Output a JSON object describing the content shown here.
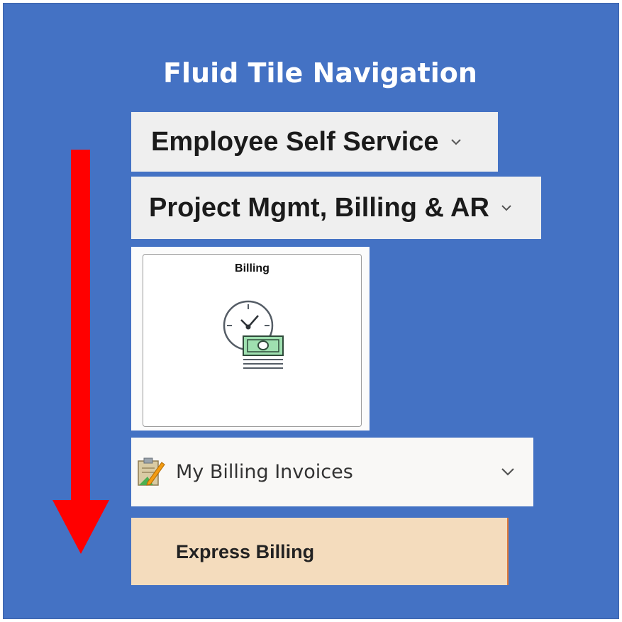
{
  "page": {
    "title": "Fluid Tile Navigation"
  },
  "navigation": {
    "menu_1": {
      "label": "Employee Self Service",
      "icon": "chevron-down-icon"
    },
    "menu_2": {
      "label": "Project Mgmt, Billing & AR",
      "icon": "chevron-down-icon"
    }
  },
  "tile": {
    "title": "Billing",
    "icon": "clock-money-icon"
  },
  "list": {
    "item_1": {
      "label": "My Billing Invoices",
      "icon": "clipboard-pencil-icon",
      "expand_icon": "chevron-down-icon"
    },
    "item_2": {
      "label": "Express Billing"
    }
  },
  "colors": {
    "background": "#4472c4",
    "arrow": "#ff0000",
    "highlight": "#f4dcbd"
  }
}
